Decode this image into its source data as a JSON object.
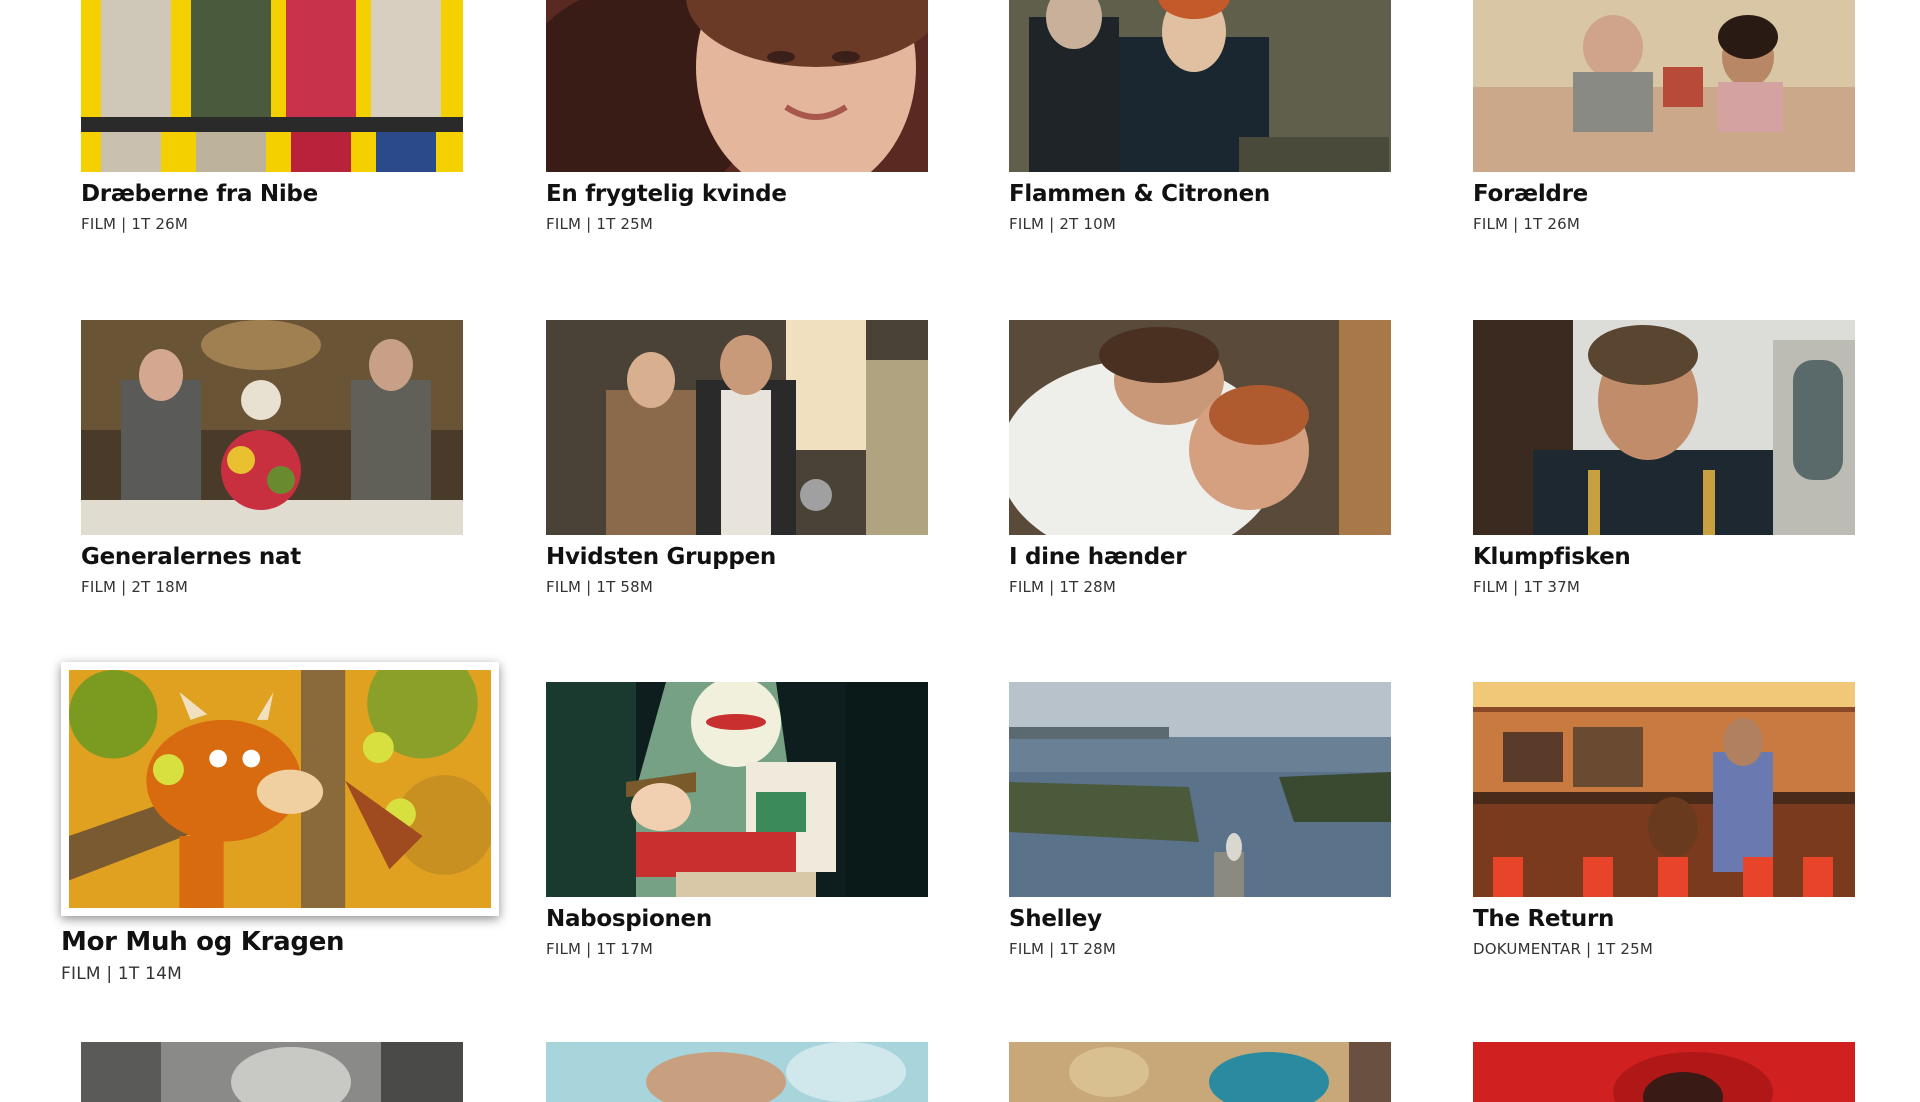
{
  "items": [
    {
      "title": "Dræberne fra Nibe",
      "meta": "FILM | 1T 26M"
    },
    {
      "title": "En frygtelig kvinde",
      "meta": "FILM | 1T 25M"
    },
    {
      "title": "Flammen & Citronen",
      "meta": "FILM | 2T 10M"
    },
    {
      "title": "Forældre",
      "meta": "FILM | 1T 26M"
    },
    {
      "title": "Generalernes nat",
      "meta": "FILM | 2T 18M"
    },
    {
      "title": "Hvidsten Gruppen",
      "meta": "FILM | 1T 58M"
    },
    {
      "title": "I dine hænder",
      "meta": "FILM | 1T 28M"
    },
    {
      "title": "Klumpfisken",
      "meta": "FILM | 1T 37M"
    },
    {
      "title": "Mor Muh og Kragen",
      "meta": "FILM | 1T 14M"
    },
    {
      "title": "Nabospionen",
      "meta": "FILM | 1T 17M"
    },
    {
      "title": "Shelley",
      "meta": "FILM | 1T 28M"
    },
    {
      "title": "The Return",
      "meta": "DOKUMENTAR | 1T 25M"
    }
  ],
  "focused_index": 8,
  "colors": {
    "background": "#ffffff",
    "title": "#111111",
    "meta": "#333333",
    "focus_border": "#ffffff"
  }
}
